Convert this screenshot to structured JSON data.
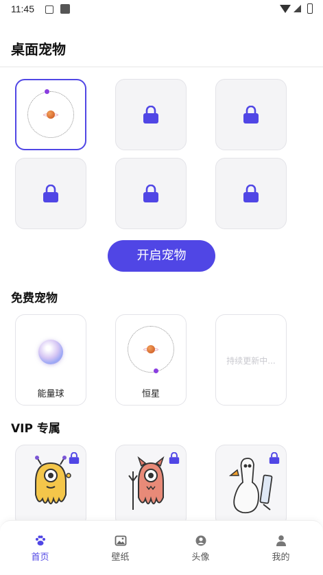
{
  "status_bar": {
    "time": "11:45"
  },
  "header": {
    "title": "桌面宠物"
  },
  "main": {
    "cta_label": "开启宠物",
    "free_section": {
      "title": "免费宠物",
      "items": [
        {
          "label": "能量球",
          "icon": "energy-ball-icon"
        },
        {
          "label": "恒星",
          "icon": "star-orbit-icon"
        },
        {
          "label": "持续更新中..."
        }
      ]
    },
    "vip_section": {
      "title": "VIP 专属"
    }
  },
  "colors": {
    "accent": "#5046e5",
    "card_bg": "#f4f4f6"
  },
  "tabs": [
    {
      "label": "首页",
      "icon": "paw-icon",
      "active": true
    },
    {
      "label": "壁纸",
      "icon": "image-icon",
      "active": false
    },
    {
      "label": "头像",
      "icon": "avatar-icon",
      "active": false
    },
    {
      "label": "我的",
      "icon": "person-icon",
      "active": false
    }
  ]
}
